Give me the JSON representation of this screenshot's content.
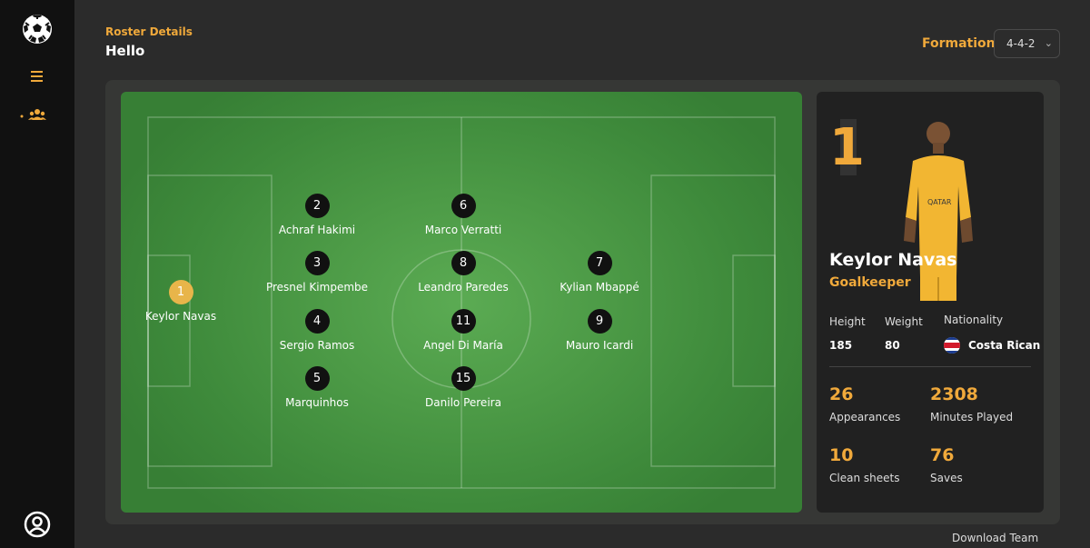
{
  "sidebar": {
    "logo_icon": "soccer-ball-icon",
    "menu_icon": "hamburger-icon",
    "nav_icon": "team-icon",
    "profile_icon": "user-circle-icon",
    "accent": "#f0a93b"
  },
  "header": {
    "breadcrumb": "Roster Details",
    "greeting": "Hello",
    "formation_label": "Formation:",
    "formation_value": "4-4-2"
  },
  "players": [
    {
      "number": "1",
      "name": "Keylor Navas",
      "active": true
    },
    {
      "number": "2",
      "name": "Achraf Hakimi"
    },
    {
      "number": "3",
      "name": "Presnel Kimpembe"
    },
    {
      "number": "4",
      "name": "Sergio Ramos"
    },
    {
      "number": "5",
      "name": "Marquinhos"
    },
    {
      "number": "6",
      "name": "Marco Verratti"
    },
    {
      "number": "8",
      "name": "Leandro Paredes"
    },
    {
      "number": "11",
      "name": "Angel Di María"
    },
    {
      "number": "15",
      "name": "Danilo Pereira"
    },
    {
      "number": "7",
      "name": "Kylian Mbappé"
    },
    {
      "number": "9",
      "name": "Mauro Icardi"
    }
  ],
  "card": {
    "number": "1",
    "name": "Keylor Navas",
    "position": "Goalkeeper",
    "height_label": "Height",
    "height": "185",
    "weight_label": "Weight",
    "weight": "80",
    "nationality_label": "Nationality",
    "nationality": "Costa Rican",
    "appearances": "26",
    "appearances_label": "Appearances",
    "minutes": "2308",
    "minutes_label": "Minutes Played",
    "clean_sheets": "10",
    "clean_sheets_label": "Clean sheets",
    "saves": "76",
    "saves_label": "Saves"
  },
  "footer": {
    "download_label": "Download Team"
  }
}
